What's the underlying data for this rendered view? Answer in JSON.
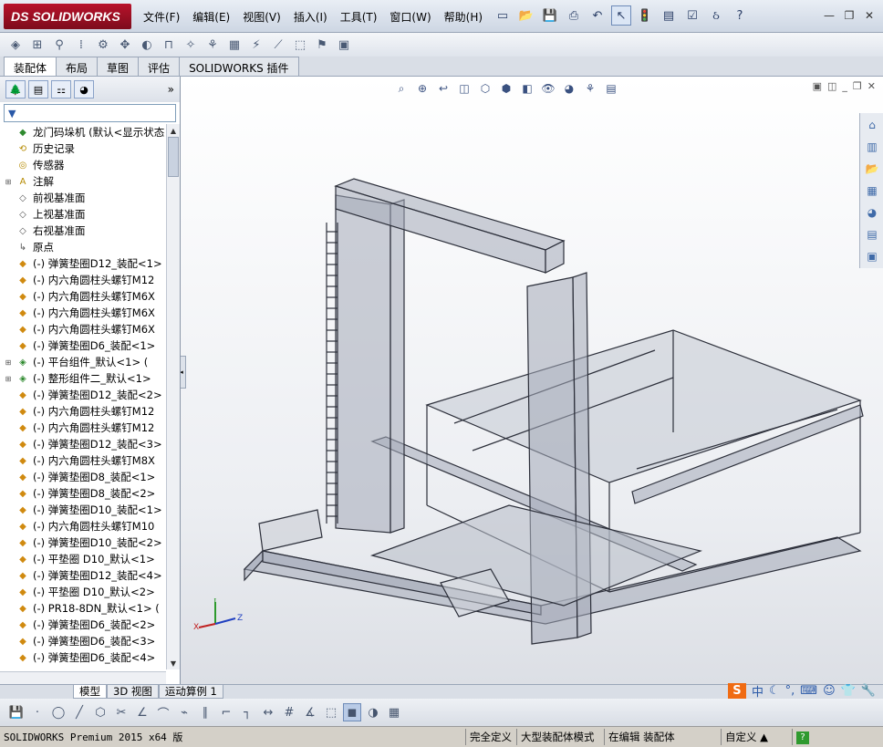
{
  "app": {
    "brand": "DS SOLIDWORKS",
    "menu": [
      "文件(F)",
      "编辑(E)",
      "视图(V)",
      "插入(I)",
      "工具(T)",
      "窗口(W)",
      "帮助(H)"
    ]
  },
  "command_tabs": [
    "装配体",
    "布局",
    "草图",
    "评估",
    "SOLIDWORKS 插件"
  ],
  "active_command_tab": "装配体",
  "feature_tree": {
    "root": "龙门码垛机  (默认<显示状态",
    "items": [
      {
        "label": "历史记录",
        "icon": "history-icon",
        "expandable": false
      },
      {
        "label": "传感器",
        "icon": "sensor-icon",
        "expandable": false
      },
      {
        "label": "注解",
        "icon": "annotation-icon",
        "expandable": true
      },
      {
        "label": "前视基准面",
        "icon": "plane-icon",
        "expandable": false
      },
      {
        "label": "上视基准面",
        "icon": "plane-icon",
        "expandable": false
      },
      {
        "label": "右视基准面",
        "icon": "plane-icon",
        "expandable": false
      },
      {
        "label": "原点",
        "icon": "origin-icon",
        "expandable": false
      },
      {
        "label": "(-) 弹簧垫圈D12_装配<1>",
        "icon": "part-icon",
        "expandable": false
      },
      {
        "label": "(-) 内六角圆柱头螺钉M12",
        "icon": "part-icon",
        "expandable": false
      },
      {
        "label": "(-) 内六角圆柱头螺钉M6X",
        "icon": "part-icon",
        "expandable": false
      },
      {
        "label": "(-) 内六角圆柱头螺钉M6X",
        "icon": "part-icon",
        "expandable": false
      },
      {
        "label": "(-) 内六角圆柱头螺钉M6X",
        "icon": "part-icon",
        "expandable": false
      },
      {
        "label": "(-) 弹簧垫圈D6_装配<1>",
        "icon": "part-icon",
        "expandable": false
      },
      {
        "label": "(-) 平台组件_默认<1> (",
        "icon": "assembly-icon",
        "expandable": true
      },
      {
        "label": "(-) 整形组件二_默认<1>",
        "icon": "assembly-icon",
        "expandable": true
      },
      {
        "label": "(-) 弹簧垫圈D12_装配<2>",
        "icon": "part-icon",
        "expandable": false
      },
      {
        "label": "(-) 内六角圆柱头螺钉M12",
        "icon": "part-icon",
        "expandable": false
      },
      {
        "label": "(-) 内六角圆柱头螺钉M12",
        "icon": "part-icon",
        "expandable": false
      },
      {
        "label": "(-) 弹簧垫圈D12_装配<3>",
        "icon": "part-icon",
        "expandable": false
      },
      {
        "label": "(-) 内六角圆柱头螺钉M8X",
        "icon": "part-icon",
        "expandable": false
      },
      {
        "label": "(-) 弹簧垫圈D8_装配<1>",
        "icon": "part-icon",
        "expandable": false
      },
      {
        "label": "(-) 弹簧垫圈D8_装配<2>",
        "icon": "part-icon",
        "expandable": false
      },
      {
        "label": "(-) 弹簧垫圈D10_装配<1>",
        "icon": "part-icon",
        "expandable": false
      },
      {
        "label": "(-) 内六角圆柱头螺钉M10",
        "icon": "part-icon",
        "expandable": false
      },
      {
        "label": "(-) 弹簧垫圈D10_装配<2>",
        "icon": "part-icon",
        "expandable": false
      },
      {
        "label": "(-) 平垫圈 D10_默认<1>",
        "icon": "part-icon",
        "expandable": false
      },
      {
        "label": "(-) 弹簧垫圈D12_装配<4>",
        "icon": "part-icon",
        "expandable": false
      },
      {
        "label": "(-) 平垫圈 D10_默认<2>",
        "icon": "part-icon",
        "expandable": false
      },
      {
        "label": "(-) PR18-8DN_默认<1> (",
        "icon": "part-icon",
        "expandable": false
      },
      {
        "label": "(-) 弹簧垫圈D6_装配<2>",
        "icon": "part-icon",
        "expandable": false
      },
      {
        "label": "(-) 弹簧垫圈D6_装配<3>",
        "icon": "part-icon",
        "expandable": false
      },
      {
        "label": "(-) 弹簧垫圈D6_装配<4>",
        "icon": "part-icon",
        "expandable": false
      }
    ]
  },
  "triad": {
    "x": "X",
    "y": "Y",
    "z": "Z"
  },
  "bottom_tabs": [
    "模型",
    "3D 视图",
    "运动算例 1"
  ],
  "active_bottom_tab": "模型",
  "ime": {
    "logo": "S",
    "lang": "中"
  },
  "status": {
    "version": "SOLIDWORKS Premium 2015 x64 版",
    "cells": [
      "完全定义",
      "大型装配体模式",
      "在编辑 装配体",
      "自定义 ▲"
    ],
    "help": "?"
  },
  "colors": {
    "brand": "#9b1023",
    "model_fill": "#a4aab8",
    "model_stroke": "#2c2f3a",
    "background_top": "#ffffff"
  }
}
